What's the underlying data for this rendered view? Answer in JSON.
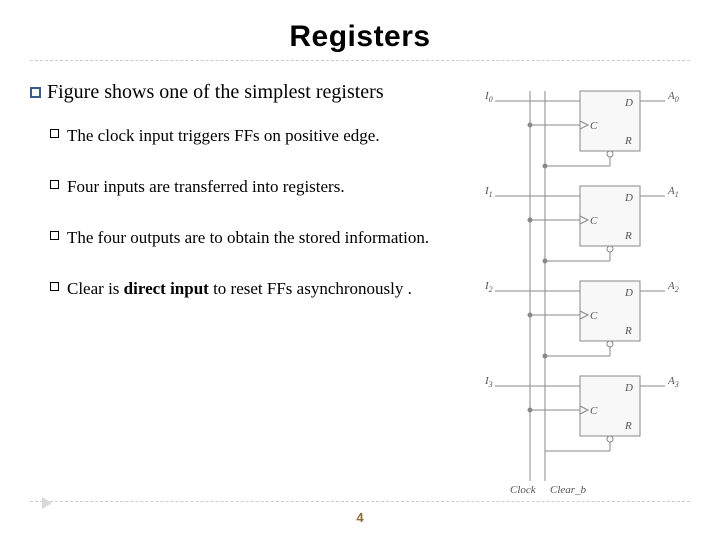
{
  "title": "Registers",
  "main_bullet": "Figure  shows one of the simplest registers",
  "sub_bullets": [
    {
      "prefix": "The clock input  triggers FFs on positive edge.",
      "bold": ""
    },
    {
      "prefix": "Four inputs are transferred into registers.",
      "bold": ""
    },
    {
      "prefix": "The four outputs are to obtain the stored information.",
      "bold": ""
    },
    {
      "prefix": "Clear is ",
      "bold": "direct input",
      "suffix": " to reset FFs asynchronously ."
    }
  ],
  "page_number": "4",
  "figure": {
    "ff_labels": {
      "d": "D",
      "c": "C",
      "r": "R"
    },
    "inputs": [
      "I",
      "I",
      "I",
      "I"
    ],
    "input_subs": [
      "0",
      "1",
      "2",
      "3"
    ],
    "outputs": [
      "A",
      "A",
      "A",
      "A"
    ],
    "output_subs": [
      "0",
      "1",
      "2",
      "3"
    ],
    "bottom_labels": {
      "clock": "Clock",
      "clear": "Clear_b"
    }
  }
}
